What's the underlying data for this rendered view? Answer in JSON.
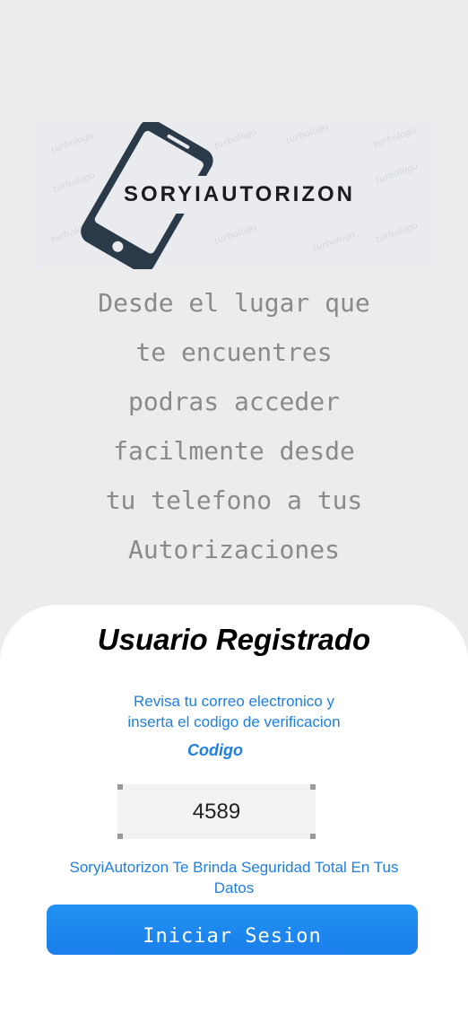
{
  "logo": {
    "brand_text": "SORYIAUTORIZON",
    "icon": "smartphone-icon",
    "watermark_text": "turbologo"
  },
  "tagline": {
    "lines": [
      "Desde el lugar que",
      "te encuentres",
      "podras acceder",
      "facilmente desde",
      "tu telefono a tus",
      "Autorizaciones"
    ]
  },
  "card": {
    "title": "Usuario Registrado",
    "instructions_line1": "Revisa tu correo electronico y",
    "instructions_line2": "inserta el codigo  de verificacion",
    "code_label": "Codigo",
    "code_value": "4589",
    "security_note": "SoryiAutorizon Te Brinda Seguridad Total En Tus Datos",
    "login_button_label": "Iniciar Sesion"
  },
  "colors": {
    "background": "#ececec",
    "accent": "#1f7fe0",
    "button": "#1a7fea",
    "logo_dark": "#2b3a48"
  }
}
